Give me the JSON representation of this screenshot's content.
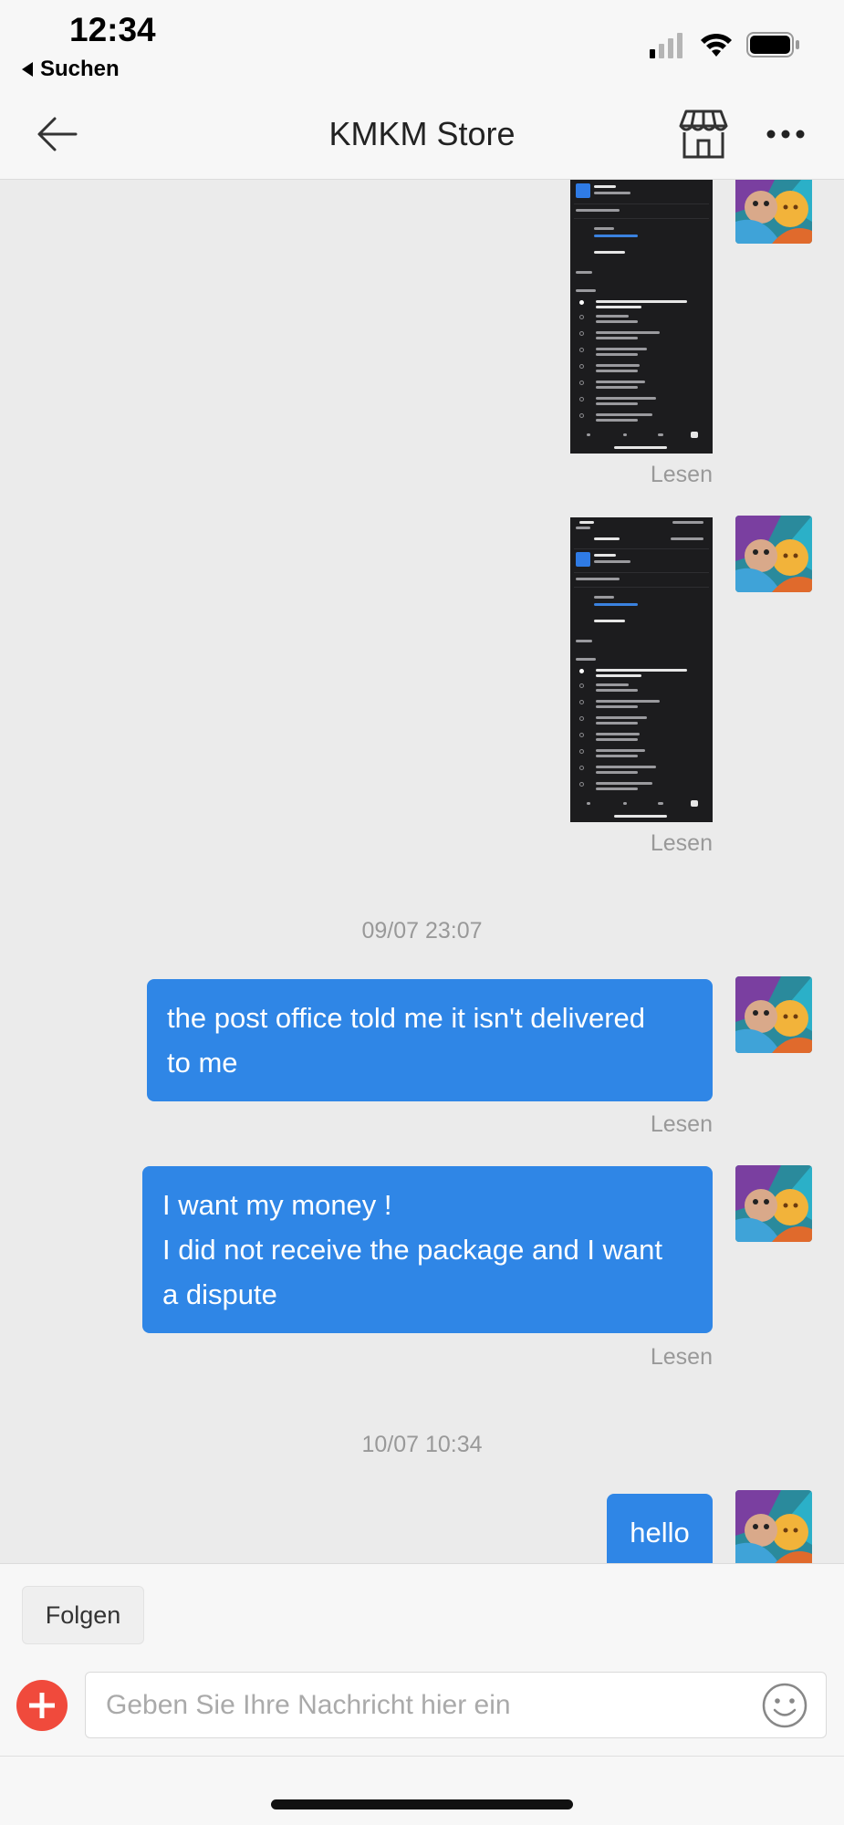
{
  "status_bar": {
    "time": "12:34",
    "back_app": "Suchen",
    "icons": [
      "signal-icon",
      "wifi-icon",
      "battery-icon"
    ]
  },
  "header": {
    "title": "KMKM Store",
    "icons": [
      "back-arrow-icon",
      "store-icon",
      "more-icon"
    ]
  },
  "messages": [
    {
      "type": "image",
      "status": "Lesen"
    },
    {
      "type": "image",
      "status": "Lesen"
    },
    {
      "type": "timestamp",
      "text": "09/07 23:07"
    },
    {
      "type": "text",
      "lines": [
        "the post office told me it isn't delivered",
        "to me"
      ],
      "status": "Lesen"
    },
    {
      "type": "text",
      "lines": [
        "I want my money !",
        "I did not receive the package and I want",
        "a dispute"
      ],
      "status": "Lesen"
    },
    {
      "type": "timestamp",
      "text": "10/07 10:34"
    },
    {
      "type": "text",
      "lines": [
        "hello"
      ]
    }
  ],
  "footer": {
    "follow_label": "Folgen",
    "input_placeholder": "Geben Sie Ihre Nachricht hier ein",
    "icons": [
      "add-icon",
      "emoji-icon"
    ]
  },
  "colors": {
    "bubble": "#2f86e6",
    "add_button": "#f04a3c",
    "background": "#ebebeb"
  }
}
